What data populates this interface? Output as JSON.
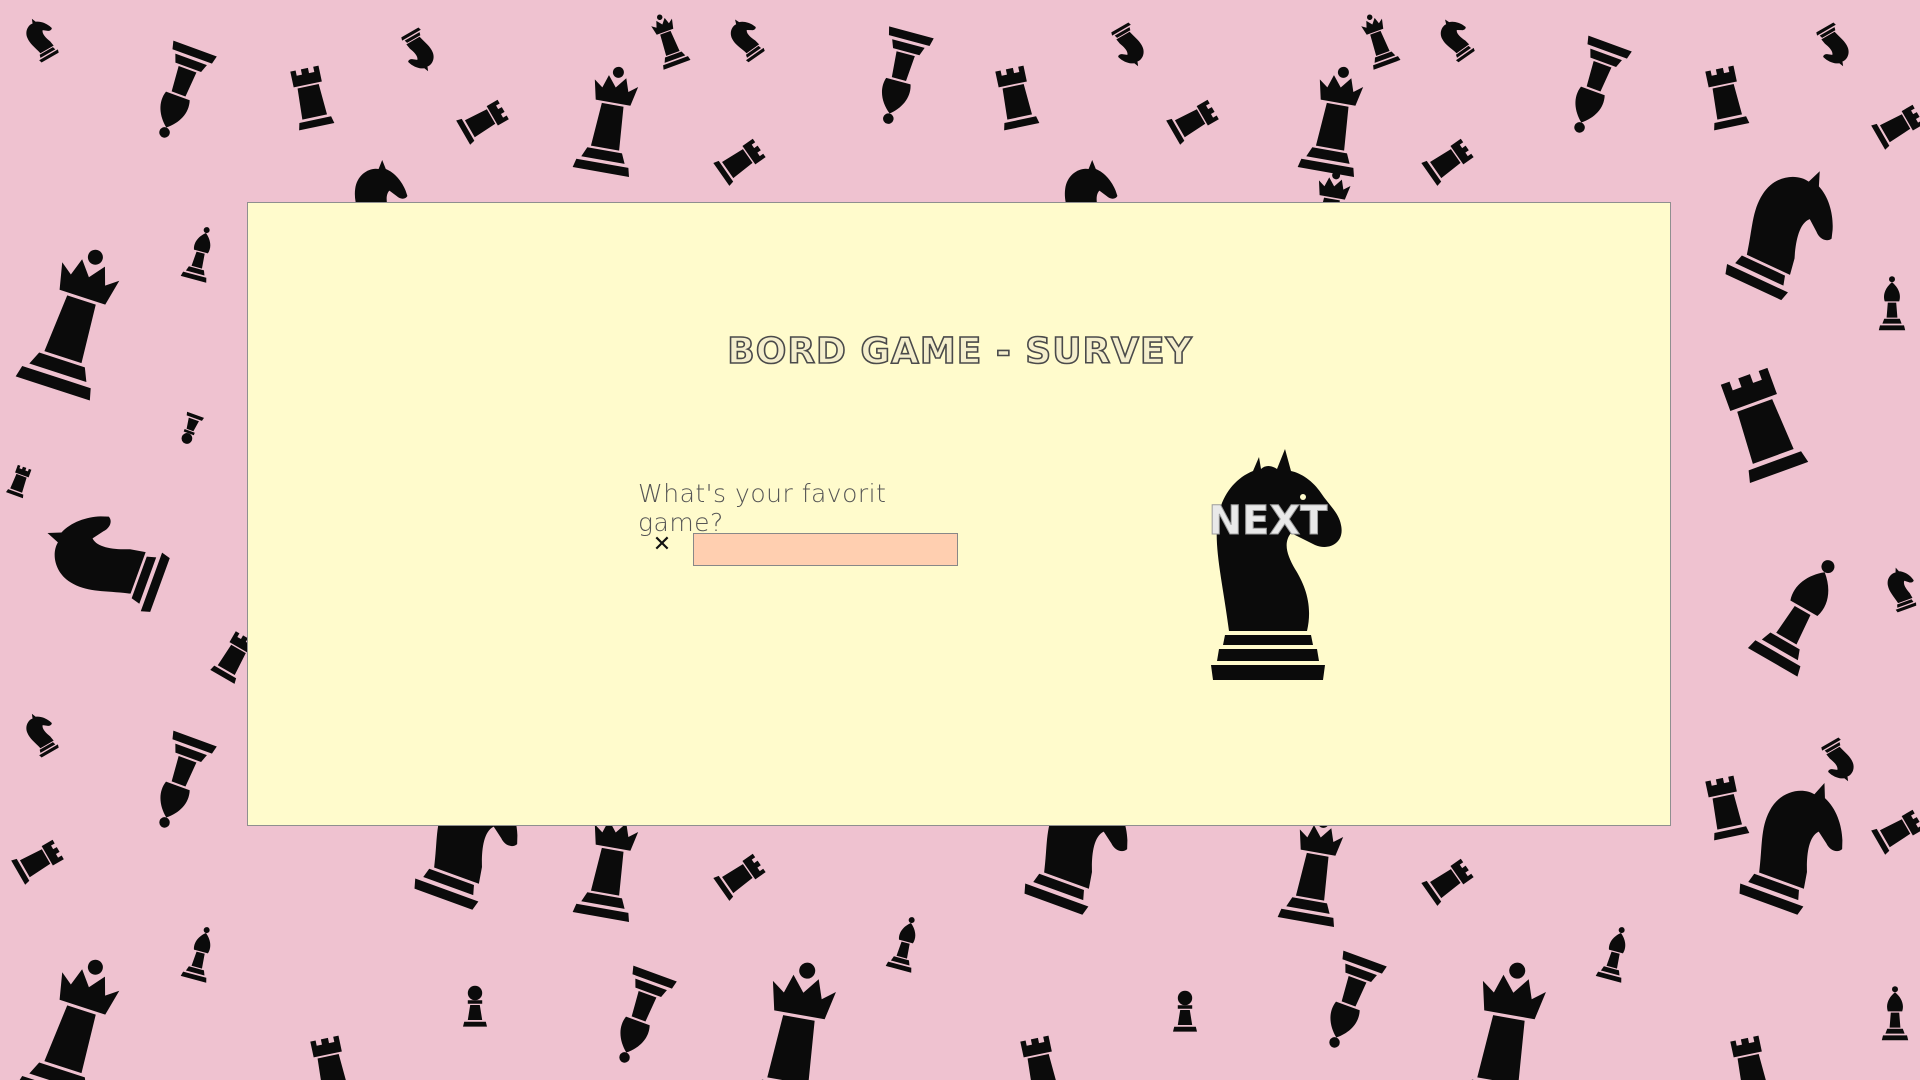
{
  "page": {
    "background_color": "#efc2d0",
    "panel_color": "#fffbcc"
  },
  "survey": {
    "title": "BORD GAME - SURVEY",
    "question": "What's your favorit game?",
    "input_value": "",
    "input_color": "#ffcfb0",
    "clear_icon": "close-icon",
    "next_label": "NEXT",
    "next_icon": "chess-knight-icon"
  },
  "background_pattern": {
    "pieces": [
      "queen",
      "bishop",
      "rook",
      "knight",
      "pawn"
    ],
    "piece_color": "#0b0b0b"
  }
}
